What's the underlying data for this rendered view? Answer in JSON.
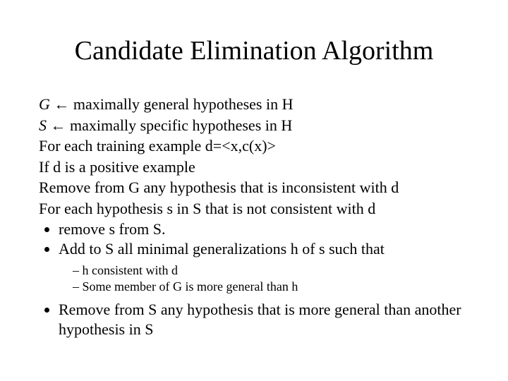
{
  "title": "Candidate Elimination Algorithm",
  "lines": {
    "l1_g": "G",
    "l1_rest": " ← maximally general hypotheses in H",
    "l2_s": "S",
    "l2_rest": " ← maximally specific hypotheses in H",
    "l3": "For each training example d=<x,c(x)>",
    "l4": "If d is a positive example",
    "l5": "Remove from G any hypothesis that is inconsistent with d",
    "l6": "For each hypothesis s in S that is not consistent with d"
  },
  "bullets1": {
    "b1": "remove s from S.",
    "b2": "Add to S all minimal generalizations h of s such that"
  },
  "sub": {
    "s1": "h consistent with d",
    "s2": "Some member of G is more general than h"
  },
  "bullets2": {
    "b1": "Remove from S any hypothesis that is more general than another hypothesis in S"
  }
}
